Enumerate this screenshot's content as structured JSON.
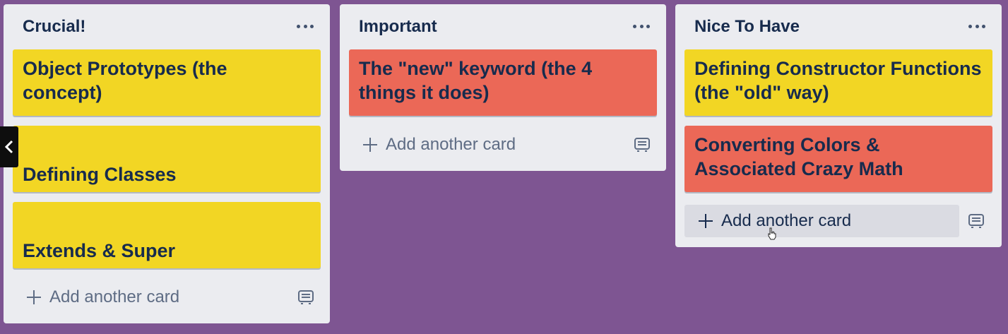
{
  "lists": [
    {
      "title": "Crucial!",
      "cards": [
        {
          "title": "Object Prototypes (the concept)",
          "color": "#f2d624"
        },
        {
          "title": "Defining Classes",
          "color": "#f2d624"
        },
        {
          "title": "Extends & Super",
          "color": "#f2d624"
        }
      ],
      "add_label": "Add another card"
    },
    {
      "title": "Important",
      "cards": [
        {
          "title": "The \"new\" keyword (the 4 things it does)",
          "color": "#eb6857"
        }
      ],
      "add_label": "Add another card"
    },
    {
      "title": "Nice To Have",
      "cards": [
        {
          "title": "Defining Constructor Functions (the \"old\" way)",
          "color": "#f2d624"
        },
        {
          "title": "Converting Colors & Associated Crazy Math",
          "color": "#eb6857"
        }
      ],
      "add_label": "Add another card"
    }
  ],
  "icons": {
    "list_menu": "more-horizontal-icon",
    "add": "plus-icon",
    "template": "card-template-icon",
    "nav": "chevron-left-icon",
    "cursor": "hand-pointer-cursor-icon"
  },
  "colors": {
    "board_background": "#7e5592",
    "list_background": "#ebecf0",
    "yellow_label": "#f2d624",
    "red_label": "#eb6857",
    "text_dark": "#172b4d"
  }
}
